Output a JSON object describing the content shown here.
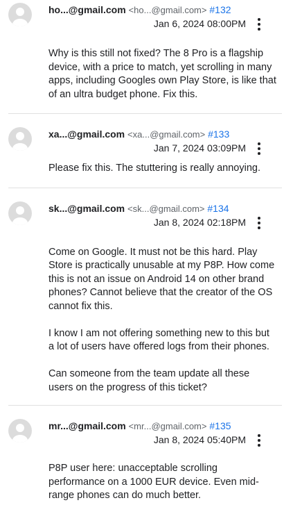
{
  "comments": [
    {
      "author": "ho...@gmail.com",
      "email": "<ho...@gmail.com>",
      "number": "#132",
      "timestamp": "Jan 6, 2024 08:00PM",
      "paragraphs": [
        "Why is this still not fixed? The 8 Pro is a flagship device, with a price to match, yet scrolling in many apps, including Googles own Play Store, is like that of an ultra budget phone. Fix this."
      ]
    },
    {
      "author": "xa...@gmail.com",
      "email": "<xa...@gmail.com>",
      "number": "#133",
      "timestamp": "Jan 7, 2024 03:09PM",
      "paragraphs": [
        "Please fix this. The stuttering is really annoying."
      ]
    },
    {
      "author": "sk...@gmail.com",
      "email": "<sk...@gmail.com>",
      "number": "#134",
      "timestamp": "Jan 8, 2024 02:18PM",
      "paragraphs": [
        "Come on Google. It must not be this hard. Play Store is practically unusable at my P8P. How come this is not an issue on Android 14 on other brand phones? Cannot believe that the creator of the OS cannot fix this.",
        "I know I am not offering something new to this but a lot of users have offered logs from their phones.",
        "Can someone from the team update all these users on the progress of this ticket?"
      ]
    },
    {
      "author": "mr...@gmail.com",
      "email": "<mr...@gmail.com>",
      "number": "#135",
      "timestamp": "Jan 8, 2024 05:40PM",
      "paragraphs": [
        "P8P user here: unacceptable scrolling performance on a 1000 EUR device. Even mid-range phones can do much better."
      ]
    }
  ]
}
